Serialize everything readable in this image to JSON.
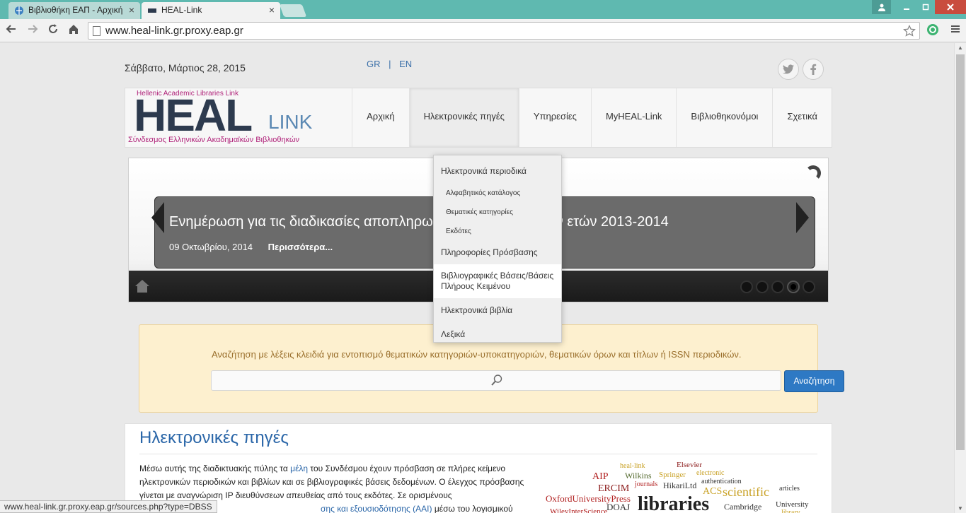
{
  "browser": {
    "tabs": [
      {
        "title": "Βιβλιοθήκη ΕΑΠ - Αρχική",
        "close": "×"
      },
      {
        "title": "HEAL-Link",
        "close": "×"
      }
    ],
    "address": "www.heal-link.gr.proxy.eap.gr",
    "status_url": "www.heal-link.gr.proxy.eap.gr/sources.php?type=DBSS",
    "accent": "#5fb9b0"
  },
  "page": {
    "date": "Σάββατο, Μάρτιος 28, 2015",
    "lang": {
      "gr": "GR",
      "sep": "|",
      "en": "EN"
    },
    "logo": {
      "top": "Hellenic Academic Libraries Link",
      "heal": "HEAL",
      "link": "LINK",
      "bottom": "Σύνδεσμος Ελληνικών Ακαδημαϊκών Βιβλιοθηκών"
    },
    "nav": [
      "Αρχική",
      "Ηλεκτρονικές πηγές",
      "Υπηρεσίες",
      "MyHEAL-Link",
      "Βιβλιοθηκονόμοι",
      "Σχετικά"
    ],
    "dropdown": {
      "periodicals": "Ηλεκτρονικά περιοδικά",
      "alpha": "Αλφαβητικός κατάλογος",
      "thematic": "Θεματικές κατηγορίες",
      "publishers": "Εκδότες",
      "access": "Πληροφορίες Πρόσβασης",
      "databases": "Βιβλιογραφικές Βάσεις/Βάσεις Πλήρους Κειμένου",
      "ebooks": "Ηλεκτρονικά βιβλία",
      "dictionaries": "Λεξικά"
    },
    "slide": {
      "title_left": "Ενημέρωση για τις διαδικασίες αποπληρω",
      "title_right": "ν ετών 2013-2014",
      "date": "09 Οκτωβρίου, 2014",
      "more": "Περισσότερα..."
    },
    "search": {
      "hint": "Αναζήτηση με λέξεις κλειδιά για εντοπισμό θεματικών κατηγοριών-υποκατηγοριών, θεματικών όρων και τίτλων ή ISSN περιοδικών.",
      "button": "Αναζήτηση"
    },
    "content": {
      "heading": "Ηλεκτρονικές πηγές",
      "p1": "Μέσω αυτής της διαδικτυακής πύλης τα ",
      "members": "μέλη",
      "p2": " του Συνδέσμου έχουν πρόσβαση σε πλήρες κείμενο ηλεκτρονικών περιοδικών και βιβλίων και σε βιβλιογραφικές βάσεις δεδομένων. Ο έλεγχος πρόσβασης γίνεται με αναγνώριση IP διευθύνσεων απευθείας από τους εκδότες. Σε ορισμένους",
      "aai": "σης και εξουσιοδότησης (AAI)",
      "p3": " μέσω του λογισμικού"
    },
    "cloud": [
      "heal-link",
      "Elsevier",
      "electronic",
      "AIP",
      "Wilkins",
      "Springer",
      "journals",
      "HikariLtd",
      "authentication",
      "ERCIM",
      "ACS",
      "scientific",
      "articles",
      "OxfordUniversityPress",
      "DOAJ",
      "libraries",
      "Cambridge",
      "University",
      "WileyInterScience",
      "library"
    ]
  }
}
